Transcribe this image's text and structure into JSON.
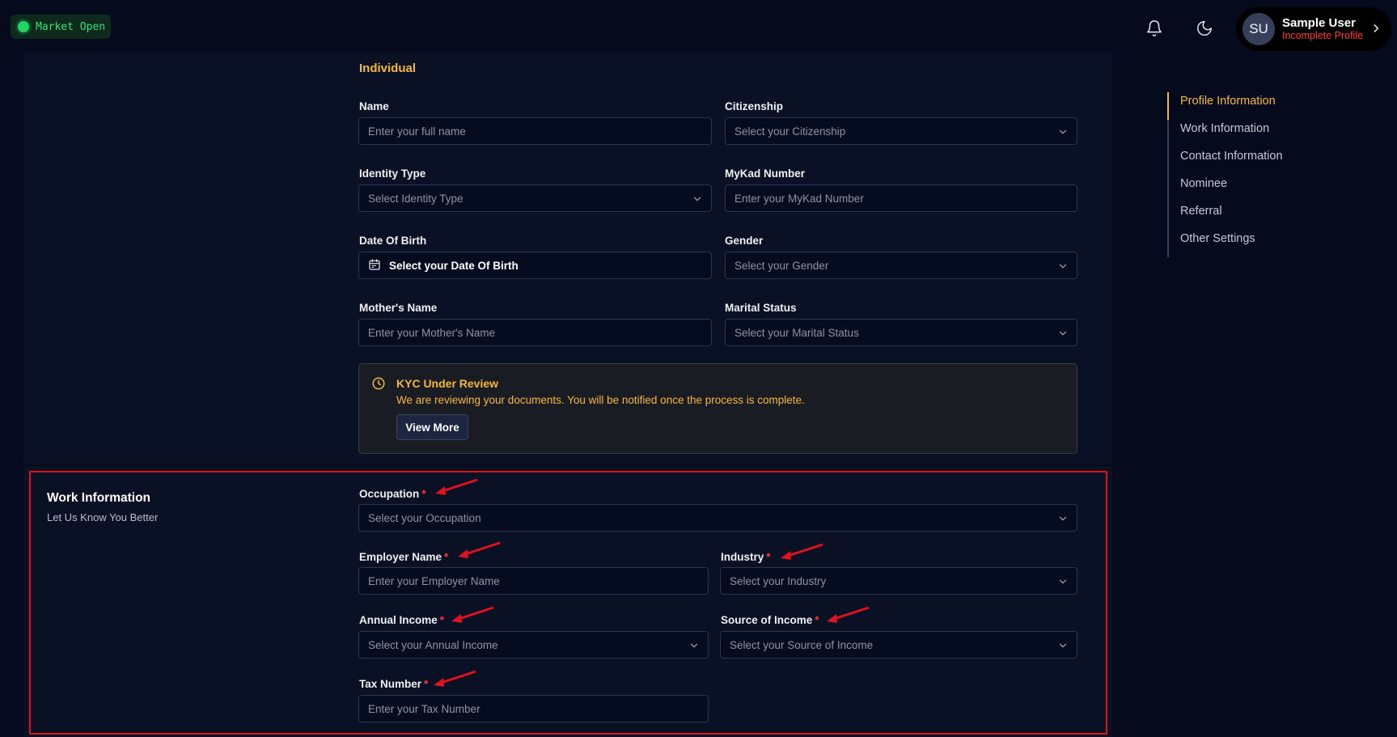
{
  "header": {
    "market_status": "Market Open",
    "user": {
      "initials": "SU",
      "name": "Sample User",
      "status": "Incomplete Profile"
    }
  },
  "individual": {
    "section_title": "Individual",
    "name": {
      "label": "Name",
      "placeholder": "Enter your full name"
    },
    "citizenship": {
      "label": "Citizenship",
      "placeholder": "Select your Citizenship"
    },
    "identity_type": {
      "label": "Identity Type",
      "placeholder": "Select Identity Type"
    },
    "mykad": {
      "label": "MyKad Number",
      "placeholder": "Enter your MyKad Number"
    },
    "dob": {
      "label": "Date Of Birth",
      "placeholder": "Select your Date Of Birth"
    },
    "gender": {
      "label": "Gender",
      "placeholder": "Select your Gender"
    },
    "mother_name": {
      "label": "Mother's Name",
      "placeholder": "Enter your Mother's Name"
    },
    "marital_status": {
      "label": "Marital Status",
      "placeholder": "Select your Marital Status"
    }
  },
  "kyc": {
    "title": "KYC Under Review",
    "message": "We are reviewing your documents. You will be notified once the process is complete.",
    "button": "View More"
  },
  "work": {
    "title": "Work Information",
    "subtitle": "Let Us Know You Better",
    "required_mark": "*",
    "occupation": {
      "label": "Occupation",
      "placeholder": "Select your Occupation"
    },
    "employer_name": {
      "label": "Employer Name",
      "placeholder": "Enter your Employer Name"
    },
    "industry": {
      "label": "Industry",
      "placeholder": "Select your Industry"
    },
    "annual_income": {
      "label": "Annual Income",
      "placeholder": "Select your Annual Income"
    },
    "source_of_income": {
      "label": "Source of Income",
      "placeholder": "Select your Source of Income"
    },
    "tax_number": {
      "label": "Tax Number",
      "placeholder": "Enter your Tax Number"
    }
  },
  "side_nav": {
    "items": [
      {
        "label": "Profile Information",
        "active": true
      },
      {
        "label": "Work Information",
        "active": false
      },
      {
        "label": "Contact Information",
        "active": false
      },
      {
        "label": "Nominee",
        "active": false
      },
      {
        "label": "Referral",
        "active": false
      },
      {
        "label": "Other Settings",
        "active": false
      }
    ]
  },
  "colors": {
    "background": "#050a1d",
    "panel": "#0a1124",
    "accent": "#f5b83d",
    "required": "#ff3b30",
    "market_green": "#1ed760",
    "highlight_red": "#e0121f"
  }
}
